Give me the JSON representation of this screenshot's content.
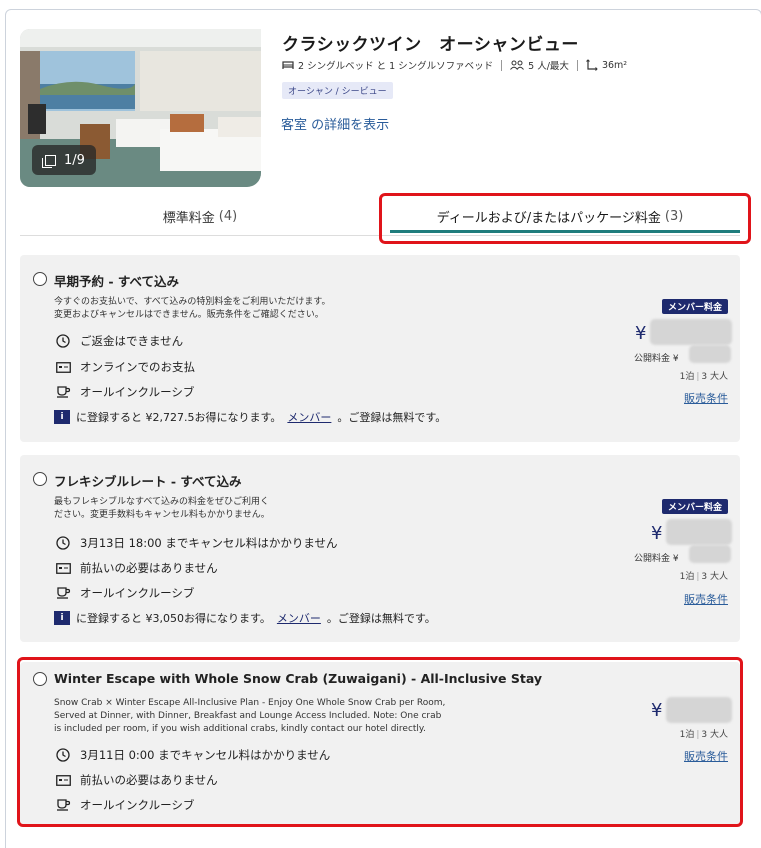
{
  "room": {
    "title": "クラシックツイン　オーシャンビュー",
    "beds": "2 シングルベッド と 1 シングルソファベッド",
    "occupancy": "5 人/最大",
    "size": "36m²",
    "tag": "オーシャン / シービュー",
    "details_link": "客室 の詳細を表示",
    "photo_counter": "1/9"
  },
  "tabs": [
    {
      "label": "標準料金",
      "count": "(4)"
    },
    {
      "label": "ディールおよび/またはパッケージ料金",
      "count": "(3)"
    }
  ],
  "rates": [
    {
      "name": "早期予約 - すべて込み",
      "desc_line1": "今すぐのお支払いで、すべて込みの特別料金をご利用いただけます。",
      "desc_line2": "変更およびキャンセルはできません。販売条件をご確認ください。",
      "features": [
        "ご返金はできません",
        "オンラインでのお支払",
        "オールインクルーシブ"
      ],
      "promo_before": "に登録すると ¥2,727.5お得になります。",
      "promo_link": "メンバー",
      "promo_after": "。ご登録は無料です。",
      "member_badge": "メンバー料金",
      "yen": "¥",
      "public_label": "公開料金 ¥",
      "per_night": "1泊",
      "guests": "3 大人",
      "terms": "販売条件"
    },
    {
      "name": "フレキシブルレート - すべて込み",
      "desc_line1": "最もフレキシブルなすべて込みの料金をぜひご利用く",
      "desc_line2": "ださい。変更手数料もキャンセル料もかかりません。",
      "features": [
        "3月13日 18:00 までキャンセル料はかかりません",
        "前払いの必要はありません",
        "オールインクルーシブ"
      ],
      "promo_before": "に登録すると ¥3,050お得になります。",
      "promo_link": "メンバー",
      "promo_after": "。ご登録は無料です。",
      "member_badge": "メンバー料金",
      "yen": "¥",
      "public_label": "公開料金 ¥",
      "per_night": "1泊",
      "guests": "3 大人",
      "terms": "販売条件"
    },
    {
      "name": "Winter Escape with Whole Snow Crab (Zuwaigani) - All-Inclusive Stay",
      "desc_line1": "Snow Crab × Winter Escape All-Inclusive Plan - Enjoy One Whole Snow Crab per Room,",
      "desc_line2": "Served at Dinner, with Dinner, Breakfast and Lounge Access Included. Note: One crab",
      "desc_line3": "is included per room, if you wish additional crabs, kindly contact our hotel directly.",
      "features": [
        "3月11日 0:00 までキャンセル料はかかりません",
        "前払いの必要はありません",
        "オールインクルーシブ"
      ],
      "yen": "¥",
      "per_night": "1泊",
      "guests": "3 大人",
      "terms": "販売条件"
    }
  ],
  "icons": {
    "bed": "bed-icon",
    "guests": "guests-icon",
    "size": "area-icon",
    "clock": "clock-icon",
    "card": "credit-card-icon",
    "cup": "coffee-cup-icon",
    "info": "member-info-icon",
    "photos": "gallery-icon"
  },
  "colors": {
    "navy": "#1e2a6e",
    "teal_underline": "#1f7d7d",
    "link": "#2a5c9a",
    "highlight_red": "#e0141a",
    "card_bg": "#f1f1f1"
  }
}
